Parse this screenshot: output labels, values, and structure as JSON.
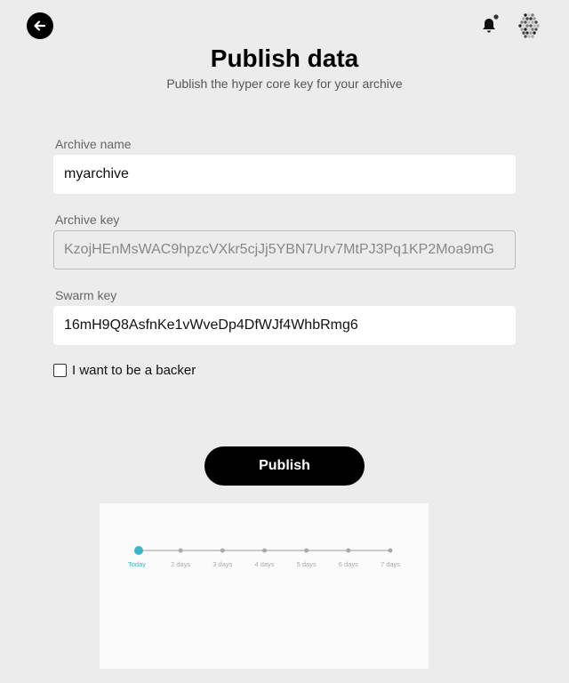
{
  "header": {
    "back_icon": "arrow-left-icon",
    "bell_icon": "bell-icon",
    "avatar_icon": "identicon-avatar"
  },
  "page": {
    "title": "Publish data",
    "subtitle": "Publish the hyper core key for your archive"
  },
  "form": {
    "archive_name_label": "Archive name",
    "archive_name_value": "myarchive",
    "archive_key_label": "Archive key",
    "archive_key_value": "KzojHEnMsWAC9hpzcVXkr5cjJj5YBN7Urv7MtPJ3Pq1KP2Moa9mG",
    "swarm_key_label": "Swarm key",
    "swarm_key_value": "16mH9Q8AsfnKe1vWveDp4DfWJf4WhbRmg6",
    "backer_label": "I want to be a backer",
    "backer_checked": false,
    "publish_label": "Publish"
  },
  "timeline": {
    "labels": [
      "Today",
      "2 days",
      "3 days",
      "4 days",
      "5 days",
      "6 days",
      "7 days"
    ],
    "selected_index": 0,
    "accent": "#3ab6c6"
  }
}
